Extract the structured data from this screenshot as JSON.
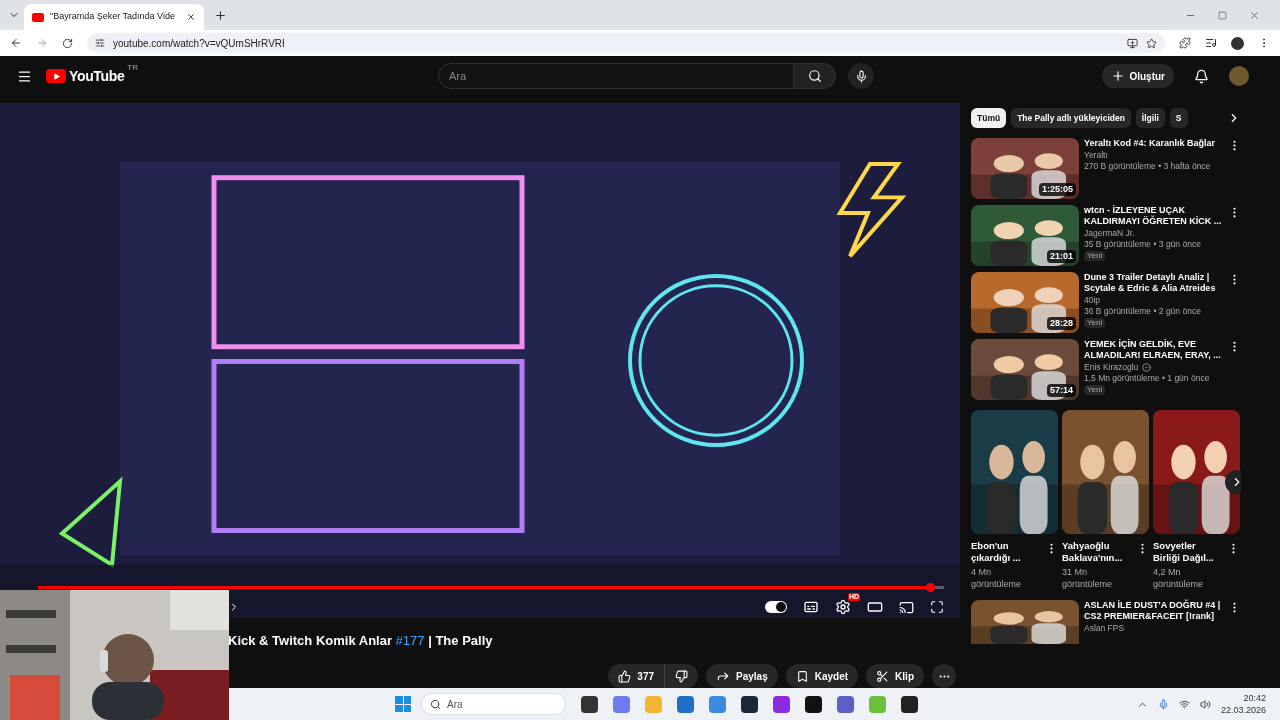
{
  "browser": {
    "tab_title": "\"Bayramda Şeker Tadında Vide",
    "url": "youtube.com/watch?v=vQUmSHrRVRI"
  },
  "header": {
    "logo": "YouTube",
    "region": "TR",
    "search_placeholder": "Ara",
    "create_label": "Oluştur"
  },
  "player": {
    "progress": {
      "level": 0.985
    },
    "autoplay": {
      "on": true
    },
    "settings_badge": "HD"
  },
  "video": {
    "title_before": "Kick & Twitch Komik Anlar",
    "hashtag": "#177",
    "title_after": "| The Pally",
    "likes": "377",
    "share": "Paylaş",
    "save": "Kaydet",
    "clip": "Klip"
  },
  "chips": [
    {
      "label": "Tümü",
      "selected": true
    },
    {
      "label": "The Pally adlı yükleyiciden",
      "selected": false
    },
    {
      "label": "İlgili",
      "selected": false
    },
    {
      "label": "S",
      "selected": false
    }
  ],
  "recommendations": [
    {
      "kind": "video",
      "title": "Yeraltı Kod #4: Karanlık Bağlar",
      "channel": "Yeraltı",
      "verified": false,
      "meta": "270 B görüntüleme • 3 hafta önce",
      "duration": "1:25:05"
    },
    {
      "kind": "video",
      "title": "wtcn - İZLEYENE UÇAK KALDIRMAYI ÖĞRETEN KİCK ...",
      "channel": "JagermaN Jr.",
      "verified": false,
      "meta": "35 B görüntüleme • 3 gün önce",
      "badge": "Yeni",
      "duration": "21:01"
    },
    {
      "kind": "video",
      "title": "Dune 3 Trailer Detaylı Analiz | Scytale & Edric & Alia Atreides",
      "channel": "40ip",
      "verified": false,
      "meta": "36 B görüntüleme • 2 gün önce",
      "badge": "Yeni",
      "duration": "28:28"
    },
    {
      "kind": "video",
      "title": "YEMEK İÇİN GELDİK, EVE ALMADILAR! ELRAEN, ERAY, ...",
      "channel": "Enis Kirazoglu",
      "verified": true,
      "meta": "1,5 Mn görüntüleme • 1 gün önce",
      "badge": "Yeni",
      "duration": "57:14"
    },
    {
      "kind": "shorts",
      "items": [
        {
          "title": "Ebon'un çıkardığı ...",
          "views": "4 Mn görüntüleme"
        },
        {
          "title": "Yahyaoğlu Baklava'nın...",
          "views": "31 Mn görüntüleme"
        },
        {
          "title": "Sovyetler Birliği Dağıl...",
          "views": "4,2 Mn görüntüleme"
        }
      ]
    },
    {
      "kind": "video",
      "title": "ASLAN İLE DUST'A DOĞRU #4 | CS2 PREMIER&FACEIT [!rank]",
      "channel": "Aslan FPS",
      "verified": false
    }
  ],
  "taskbar": {
    "search_placeholder": "Ara",
    "time": "20:42",
    "date": "22.03.2026"
  }
}
